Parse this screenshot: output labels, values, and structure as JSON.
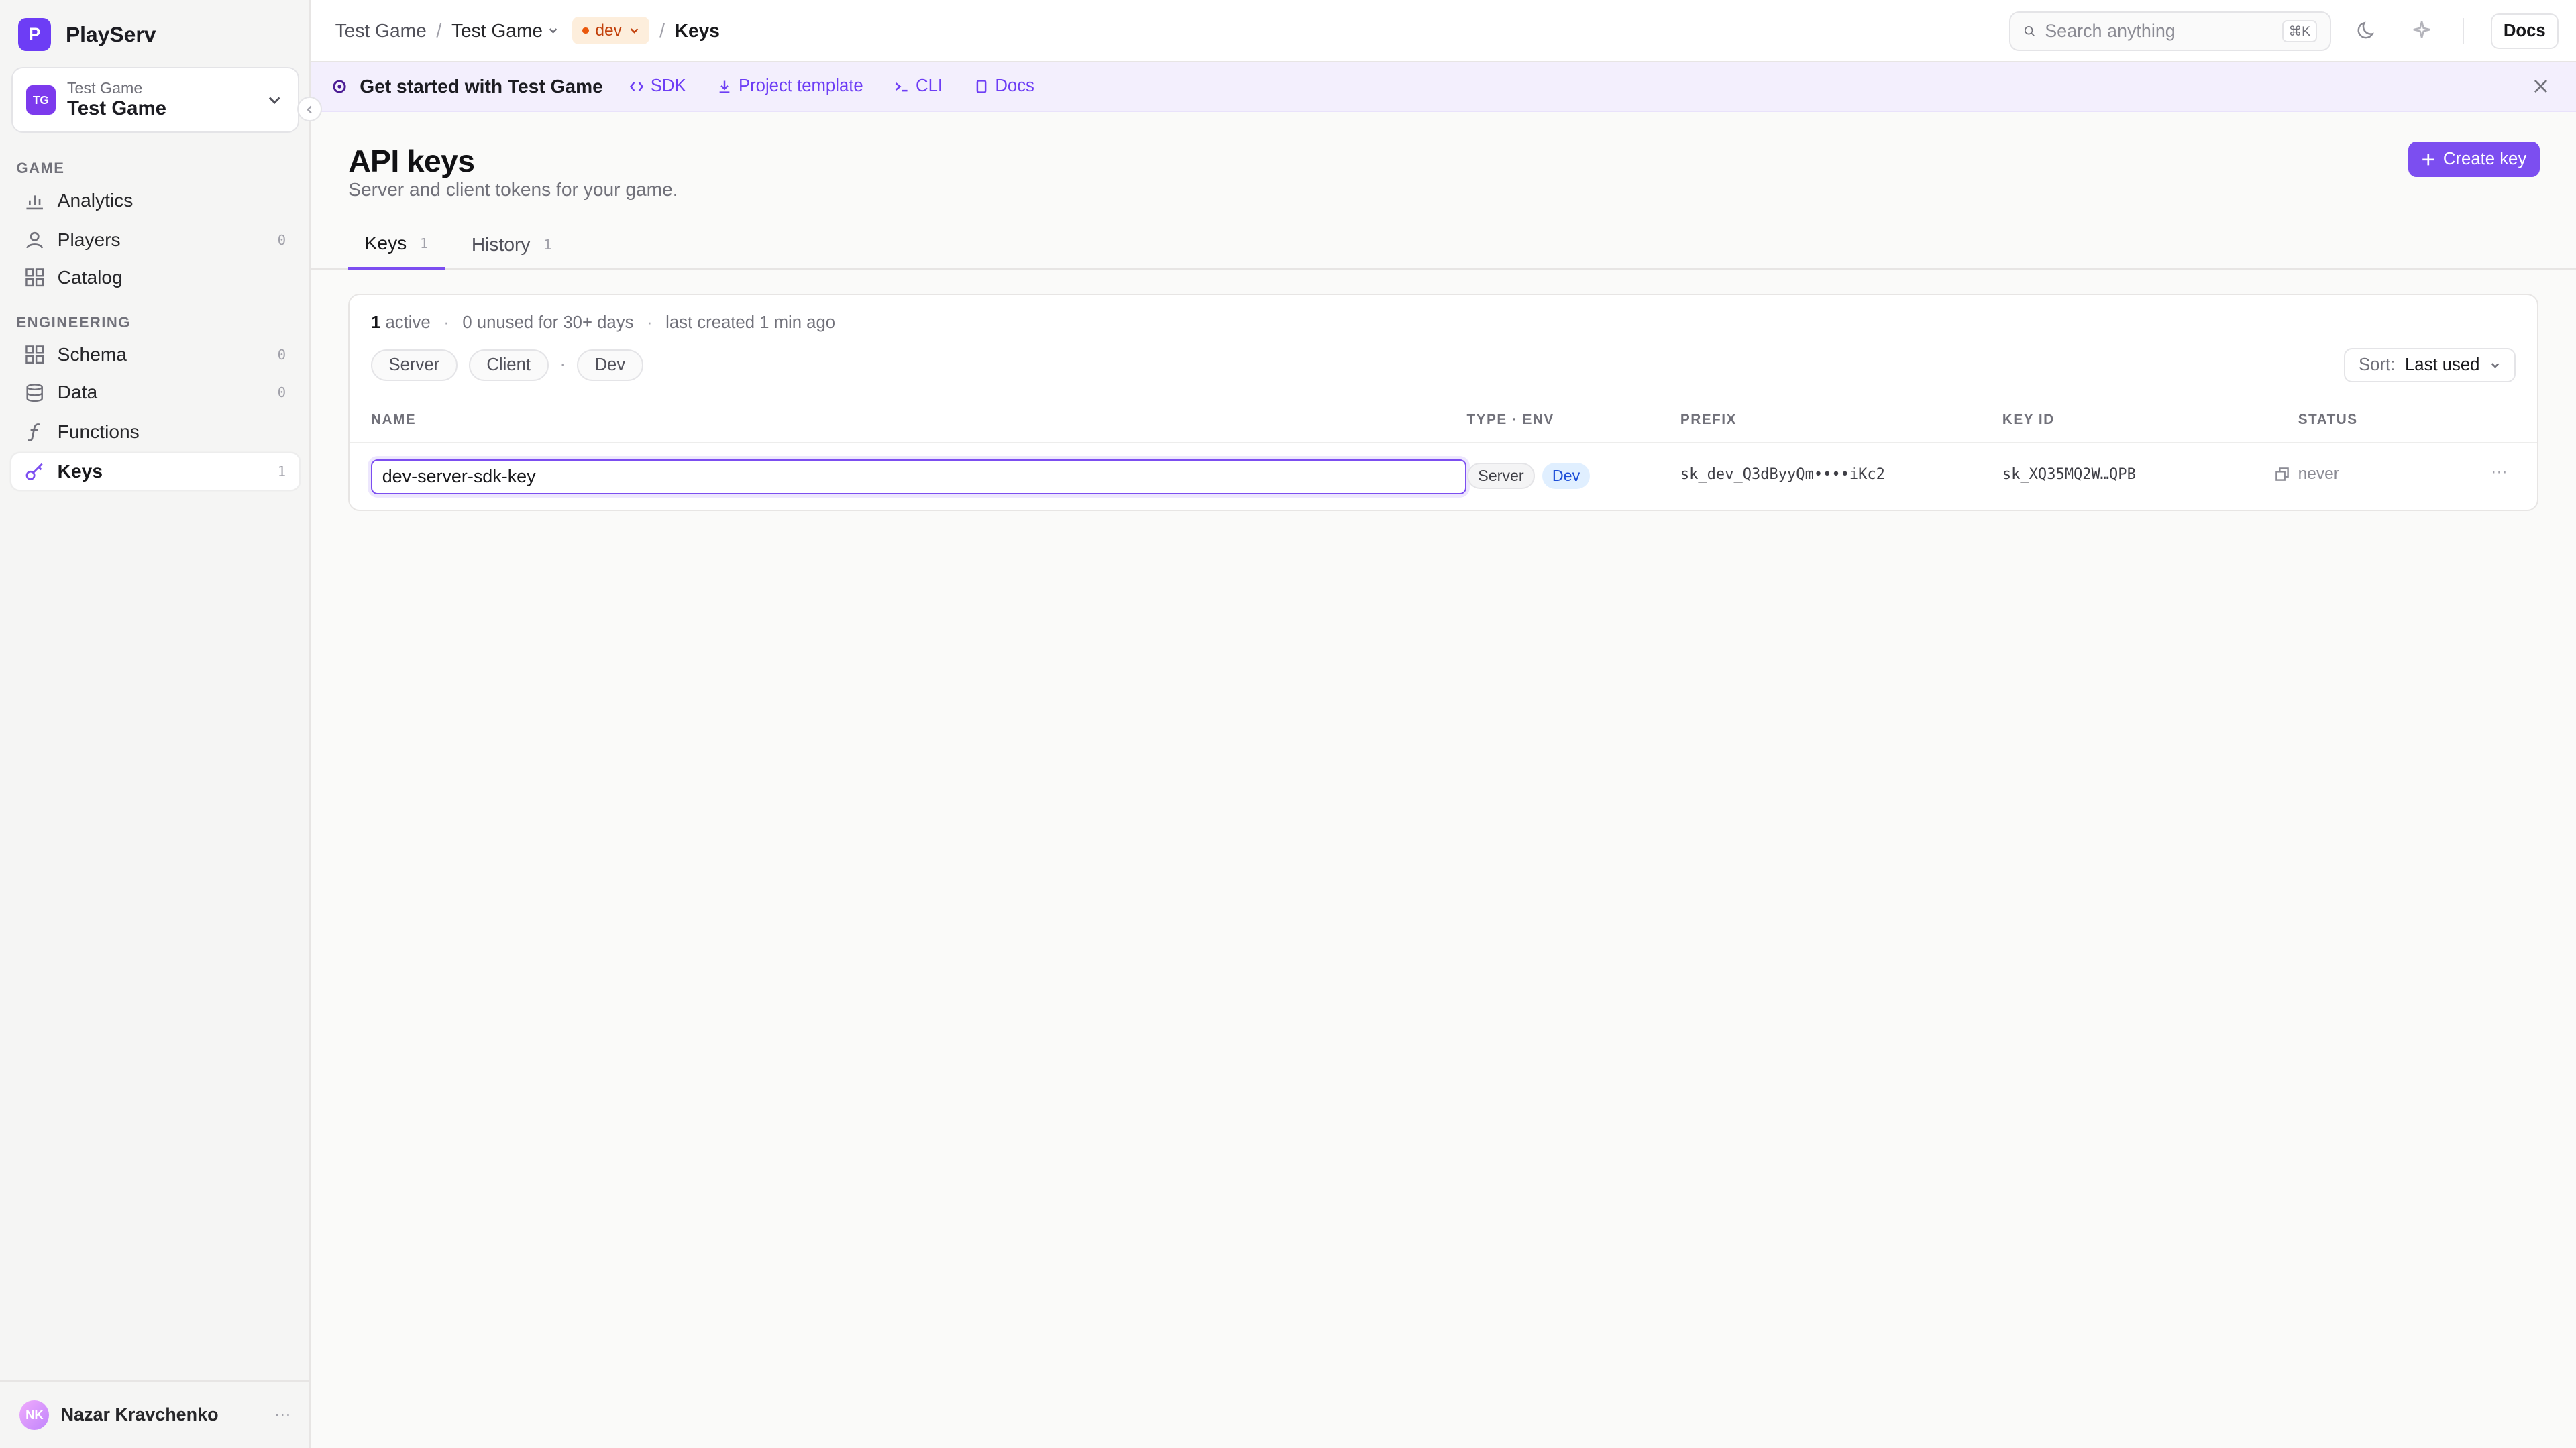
{
  "app": {
    "name": "PlayServ",
    "logo_letter": "P"
  },
  "project": {
    "initials": "TG",
    "subtitle": "Test Game",
    "name": "Test Game"
  },
  "sidebar": {
    "sections": [
      {
        "label": "GAME",
        "items": [
          {
            "label": "Analytics",
            "icon": "bar-chart-icon",
            "count": ""
          },
          {
            "label": "Players",
            "icon": "user-icon",
            "count": "0"
          },
          {
            "label": "Catalog",
            "icon": "grid-icon",
            "count": ""
          }
        ]
      },
      {
        "label": "ENGINEERING",
        "items": [
          {
            "label": "Schema",
            "icon": "grid-icon",
            "count": "0"
          },
          {
            "label": "Data",
            "icon": "database-icon",
            "count": "0"
          },
          {
            "label": "Functions",
            "icon": "function-icon",
            "count": ""
          },
          {
            "label": "Keys",
            "icon": "key-icon",
            "count": "1",
            "active": true
          }
        ]
      }
    ]
  },
  "user": {
    "initials": "NK",
    "name": "Nazar Kravchenko",
    "more": "···"
  },
  "breadcrumb": {
    "org": "Test Game",
    "project": "Test Game",
    "env": "dev",
    "sep": "/",
    "current": "Keys"
  },
  "search": {
    "placeholder": "Search anything",
    "shortcut": "⌘K"
  },
  "topbar": {
    "docs_label": "Docs"
  },
  "banner": {
    "title": "Get started with Test Game",
    "links": [
      {
        "label": "SDK",
        "icon": "code-icon"
      },
      {
        "label": "Project template",
        "icon": "download-icon"
      },
      {
        "label": "CLI",
        "icon": "terminal-icon"
      },
      {
        "label": "Docs",
        "icon": "book-icon"
      }
    ]
  },
  "page": {
    "title": "API keys",
    "subtitle": "Server and client tokens for your game.",
    "create_label": "Create key"
  },
  "tabs": [
    {
      "label": "Keys",
      "count": "1",
      "active": true
    },
    {
      "label": "History",
      "count": "1"
    }
  ],
  "stats": {
    "active_count": "1",
    "active_label": "active",
    "sep": "·",
    "unused": "0 unused for 30+ days",
    "last_created": "last created 1 min ago"
  },
  "filters": {
    "server": "Server",
    "client": "Client",
    "sep": "·",
    "dev": "Dev"
  },
  "sort": {
    "label": "Sort:",
    "value": "Last used"
  },
  "table": {
    "columns": {
      "name": "NAME",
      "type_env": "TYPE · ENV",
      "prefix": "PREFIX",
      "key_id": "KEY ID",
      "status": "STATUS"
    },
    "rows": [
      {
        "name": "dev-server-sdk-key",
        "type": "Server",
        "env": "Dev",
        "prefix": "sk_dev_Q3dByyQm••••iKc2",
        "key_id": "sk_XQ35MQ2W…QPB",
        "status": "never",
        "more": "···"
      }
    ]
  },
  "colors": {
    "accent": "#7c4ef0",
    "env_dev_bg": "#fdeedc",
    "env_dev_text": "#c2410c",
    "banner_bg": "#f3effd"
  }
}
